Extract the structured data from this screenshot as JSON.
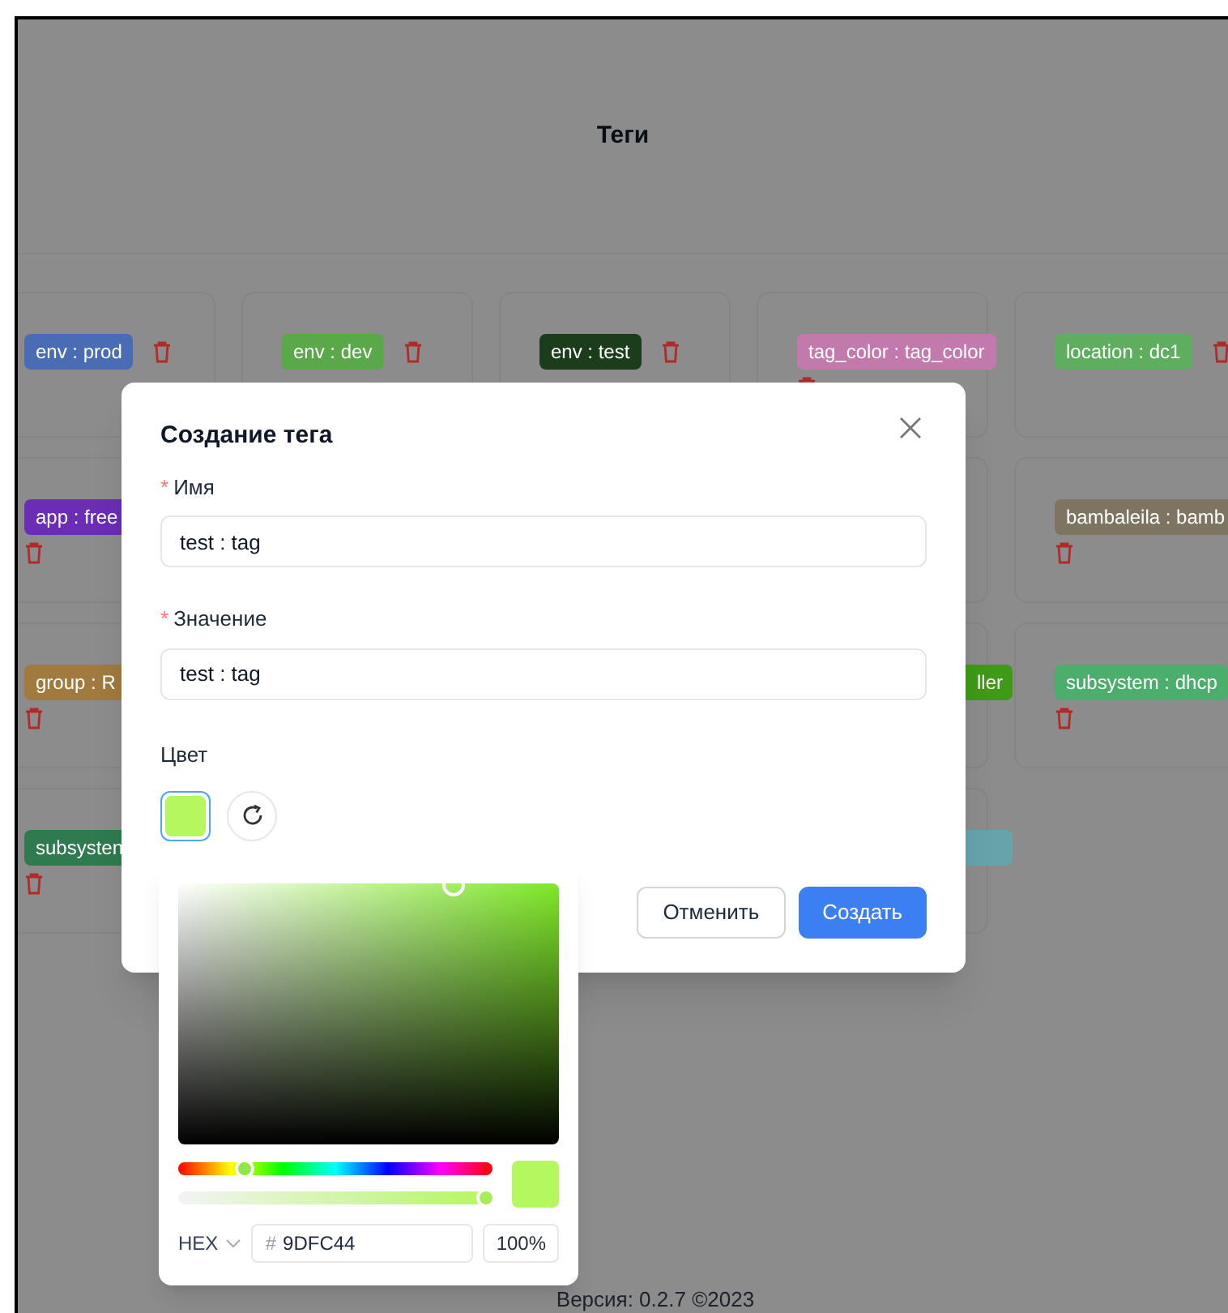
{
  "page": {
    "title": "Теги",
    "rows": [
      [
        {
          "label": "env : prod",
          "color": "#4a6cb4",
          "trash": true
        },
        {
          "label": "env : dev",
          "color": "#5aa84a",
          "trash": true
        },
        {
          "label": "env : test",
          "color": "#1c3d1c",
          "trash": true
        },
        {
          "label": "tag_color : tag_color",
          "color": "#c27aac",
          "trash": true
        },
        {
          "label": "location : dc1",
          "color": "#5fae5f",
          "trash": true
        }
      ],
      [
        {
          "kind": "tag_cut",
          "label": "app : free",
          "color": "#6a2db4",
          "trash": true
        },
        {},
        {},
        {
          "kind": "card"
        },
        {
          "label": "bambaleila : bamb",
          "color": "#7d7562",
          "trash": true
        }
      ],
      [
        {
          "kind": "tag_cut",
          "label": "group : R",
          "color": "#a07a3e",
          "trash": true
        },
        {},
        {},
        {
          "kind": "tag_end",
          "label": "ller",
          "color": "#3e9a17",
          "trash": false
        },
        {
          "label": "subsystem : dhcp",
          "color": "#4cae6c",
          "trash": true
        }
      ],
      [
        {
          "kind": "tag_cut",
          "label": "subsysten",
          "color": "#2f7a4f",
          "trash": true
        },
        {},
        {},
        {
          "kind": "tag_end",
          "color": "#66a3ab",
          "trash": false
        }
      ]
    ],
    "footer": "Версия: 0.2.7 ©2023"
  },
  "dialog": {
    "title": "Создание тега",
    "fields": [
      {
        "label": "Имя",
        "required_mark": "*",
        "value": "test : tag"
      },
      {
        "label": "Значение",
        "required_mark": "*",
        "value": "test : tag"
      }
    ],
    "color_label": "Цвет",
    "color": "#b4f75e",
    "buttons": [
      {
        "label": "Отменить",
        "kind": "default"
      },
      {
        "label": "Создать",
        "kind": "primary"
      }
    ]
  },
  "color_picker": {
    "format": "HEX",
    "prefix": "#",
    "hex": "9DFC44",
    "alpha": "100%",
    "hue_slider": {
      "level": 0.21
    },
    "alpha_slider": {
      "level": 1
    }
  }
}
